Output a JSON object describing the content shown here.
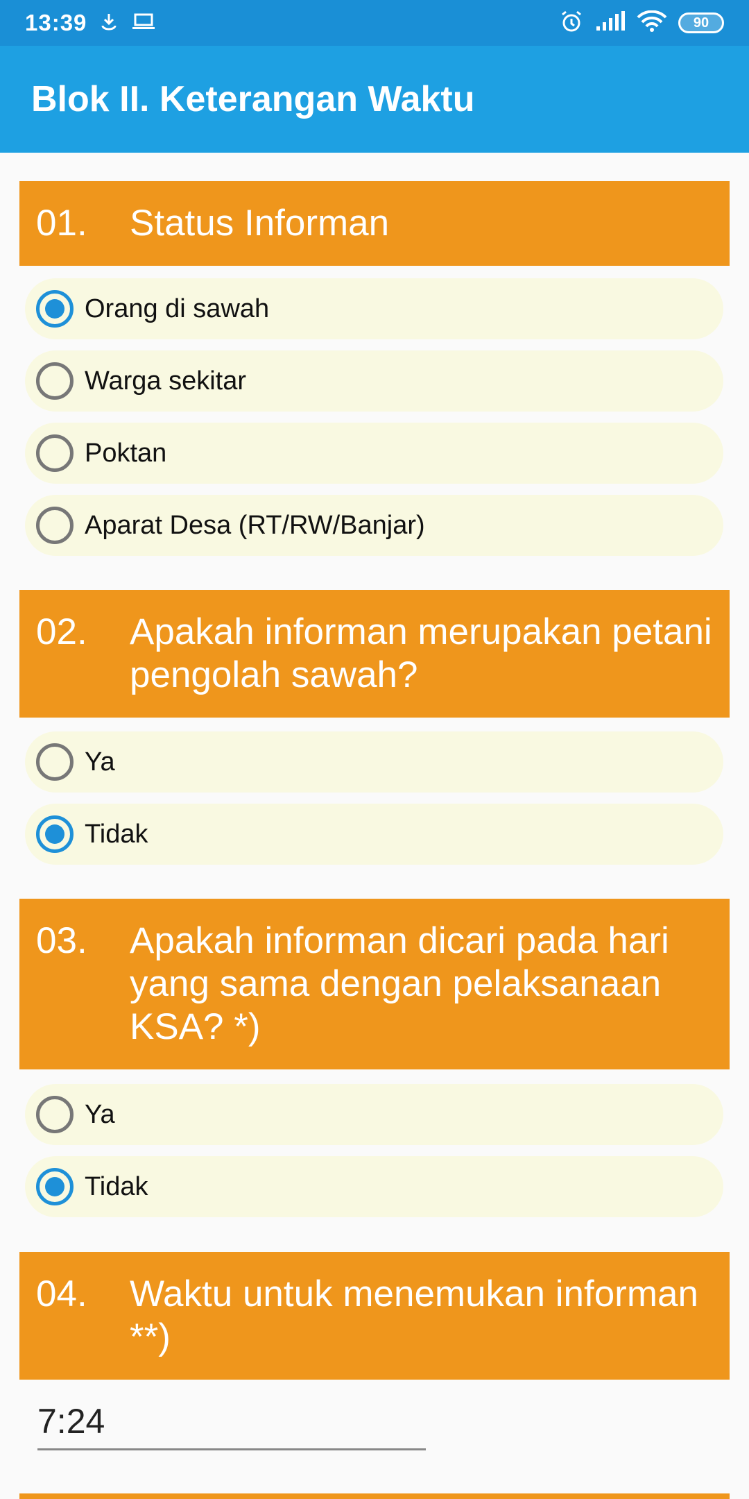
{
  "statusbar": {
    "time": "13:39",
    "battery": "90"
  },
  "appbar": {
    "title": "Blok II. Keterangan Waktu"
  },
  "questions": [
    {
      "num": "01.",
      "text": "Status Informan",
      "options": [
        {
          "label": "Orang di sawah",
          "checked": true
        },
        {
          "label": "Warga sekitar",
          "checked": false
        },
        {
          "label": "Poktan",
          "checked": false
        },
        {
          "label": "Aparat Desa (RT/RW/Banjar)",
          "checked": false
        }
      ]
    },
    {
      "num": "02.",
      "text": "Apakah informan merupakan petani pengolah sawah?",
      "options": [
        {
          "label": "Ya",
          "checked": false
        },
        {
          "label": "Tidak",
          "checked": true
        }
      ]
    },
    {
      "num": "03.",
      "text": "Apakah informan dicari pada hari yang sama dengan pelaksanaan KSA? *)",
      "options": [
        {
          "label": "Ya",
          "checked": false
        },
        {
          "label": "Tidak",
          "checked": true
        }
      ]
    },
    {
      "num": "04.",
      "text": "Waktu untuk menemukan informan **)",
      "value": "7:24"
    }
  ],
  "colors": {
    "statusbar": "#1a8fd6",
    "appbar": "#1ea0e2",
    "header": "#ef961c",
    "option_bg": "#f9f9e1",
    "radio_checked": "#1e90d8"
  }
}
